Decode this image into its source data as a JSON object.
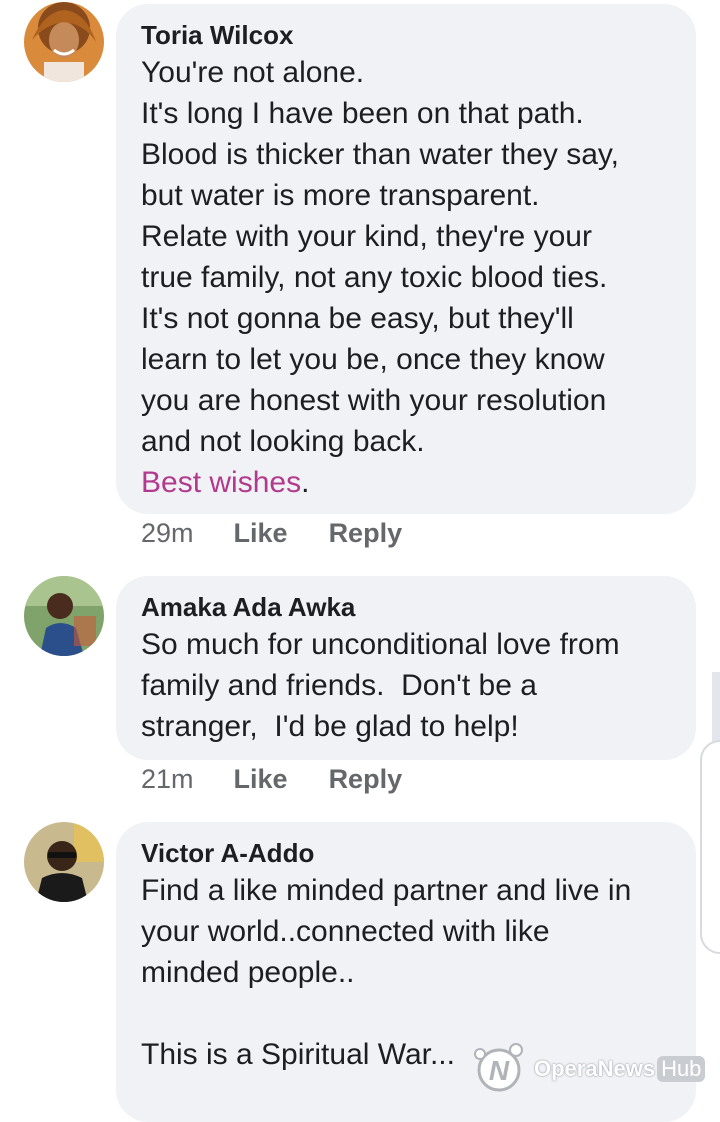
{
  "comments": [
    {
      "author": "Toria Wilcox",
      "lines": [
        "You're not alone.",
        "It's long I have been on that path.",
        "Blood is thicker than water they say,",
        "but water is more transparent.",
        "Relate with your kind, they're your",
        "true family, not any toxic blood ties.",
        "It's not gonna be easy, but they'll",
        "learn to let you be, once they know",
        "you are honest with your resolution",
        "and not looking back."
      ],
      "highlight": "Best wishes",
      "highlight_suffix": ".",
      "time": "29m",
      "like": "Like",
      "reply": "Reply"
    },
    {
      "author": "Amaka Ada Awka",
      "lines": [
        "So much for unconditional love from",
        "family and friends.  Don't be a",
        "stranger,  I'd be glad to help!"
      ],
      "time": "21m",
      "like": "Like",
      "reply": "Reply"
    },
    {
      "author": "Victor A-Addo",
      "lines": [
        "Find a like minded partner and live in",
        "your world..connected with like",
        "minded people..",
        "",
        "This is a Spiritual War..."
      ]
    }
  ],
  "watermark": {
    "brand": "OperaNews",
    "suffix": "Hub"
  },
  "colors": {
    "bubble": "#f0f2f5",
    "highlight": "#b3398f",
    "meta": "#65676b"
  }
}
